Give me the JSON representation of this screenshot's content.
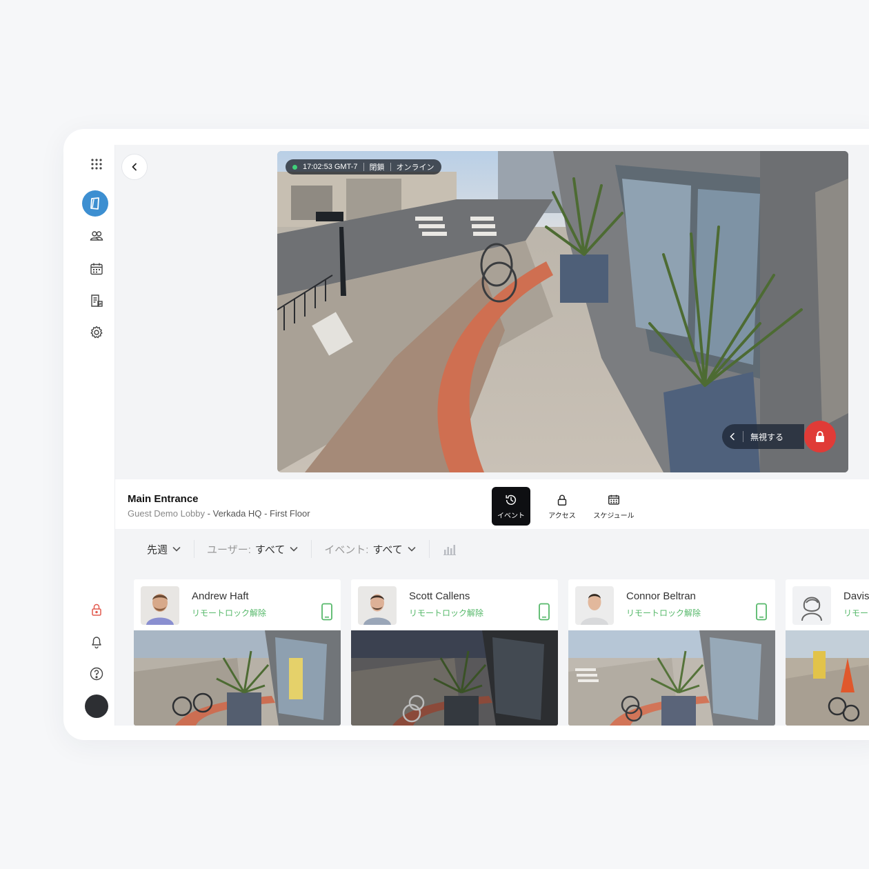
{
  "camera": {
    "timestamp": "17:02:53 GMT-7",
    "door_state": "閉鎖",
    "connection": "オンライン",
    "ignore_label": "無視する"
  },
  "door": {
    "title": "Main Entrance",
    "location_room": "Guest Demo Lobby",
    "location_site": "Verkada HQ",
    "location_floor": "First Floor",
    "separator": "-"
  },
  "tabs": {
    "events": "イベント",
    "access": "アクセス",
    "schedule": "スケジュール"
  },
  "filters": {
    "date": "先週",
    "user_label": "ユーザー:",
    "user_value": "すべて",
    "event_label": "イベント:",
    "event_value": "すべて"
  },
  "events": [
    {
      "name": "Andrew Haft",
      "action": "リモートロック解除"
    },
    {
      "name": "Scott Callens",
      "action": "リモートロック解除"
    },
    {
      "name": "Connor Beltran",
      "action": "リモートロック解除"
    },
    {
      "name": "Davis",
      "action": "リモー"
    }
  ],
  "colors": {
    "accent": "#3d8fd1",
    "unlock_green": "#56b86a",
    "lock_red": "#e03b37",
    "online": "#3fd17a"
  },
  "icons": [
    "apps-grid-icon",
    "door-icon",
    "users-icon",
    "calendar-icon",
    "report-icon",
    "gear-icon",
    "lock-icon",
    "bell-icon",
    "help-icon",
    "chevron-left-icon",
    "history-icon",
    "calendar-grid-icon",
    "chevron-down-icon",
    "bar-chart-icon",
    "phone-icon"
  ]
}
